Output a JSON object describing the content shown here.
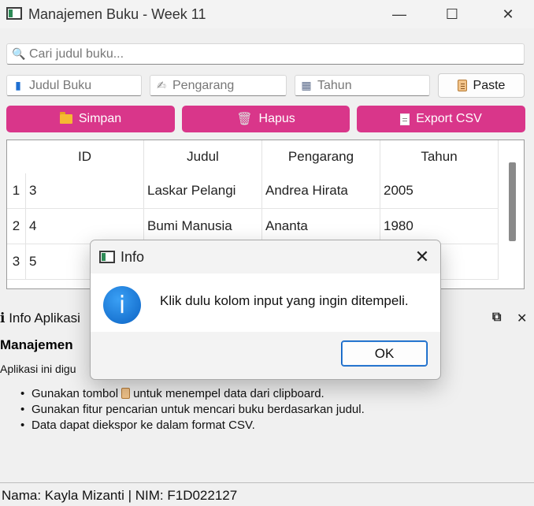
{
  "window": {
    "title": "Manajemen Buku - Week 11",
    "minimize_glyph": "—",
    "maximize_glyph": "☐",
    "close_glyph": "✕"
  },
  "search": {
    "placeholder": "Cari judul buku...",
    "icon": "search-icon"
  },
  "form": {
    "judul_placeholder": "Judul Buku",
    "pengarang_placeholder": "Pengarang",
    "tahun_placeholder": "Tahun",
    "paste_label": "Paste"
  },
  "actions": {
    "simpan_label": "Simpan",
    "hapus_label": "Hapus",
    "export_label": "Export CSV",
    "button_color": "#d9368a"
  },
  "table": {
    "headers": [
      "ID",
      "Judul",
      "Pengarang",
      "Tahun"
    ],
    "rows": [
      {
        "index": "1",
        "id": "3",
        "judul": "Laskar Pelangi",
        "pengarang": "Andrea Hirata",
        "tahun": "2005"
      },
      {
        "index": "2",
        "id": "4",
        "judul": "Bumi Manusia",
        "pengarang": "Ananta",
        "tahun": "1980"
      },
      {
        "index": "3",
        "id": "5",
        "judul": "",
        "pengarang": "",
        "tahun": ""
      }
    ]
  },
  "dock": {
    "title_icon": "i",
    "title": "Info Aplikasi",
    "heading": "Manajemen",
    "paragraph": "Aplikasi ini digu",
    "bullets": {
      "b1_before": "Gunakan tombol",
      "b1_after": "untuk menempel data dari clipboard.",
      "b2": "Gunakan fitur pencarian untuk mencari buku berdasarkan judul.",
      "b3": "Data dapat diekspor ke dalam format CSV."
    },
    "float_glyph": "⧉",
    "close_glyph": "✕"
  },
  "status": {
    "text": "Nama: Kayla Mizanti | NIM: F1D022127"
  },
  "dialog": {
    "title": "Info",
    "message": "Klik dulu kolom input yang ingin ditempeli.",
    "ok_label": "OK",
    "info_glyph": "i",
    "close_glyph": "✕"
  }
}
